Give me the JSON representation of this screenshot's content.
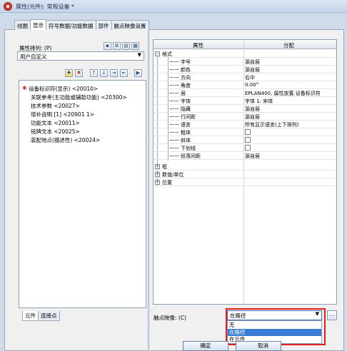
{
  "window": {
    "title": "属性(元件): 常规设备 *"
  },
  "tabs": [
    "线圈",
    "显示",
    "符号数据/功能数据",
    "部件",
    "触点映像设置"
  ],
  "left_panel": {
    "sort_label": "属性排列: (P)",
    "sort_value": "用户自定义",
    "items": [
      "设备标识符(显示) <20010>",
      "关联参考(主功能或辅助功能) <20300>",
      "技术参数 <20027>",
      "增补说明 [1] <20901 1>",
      "功能文本 <20011>",
      "铭牌文本 <20025>",
      "装配地点(描述性) <20024>"
    ],
    "bottom_tabs": [
      "元件",
      "连接点"
    ]
  },
  "property_grid": {
    "header_property": "属性",
    "header_value": "分配",
    "format_group": "格式",
    "rows": [
      {
        "label": "字号",
        "value": "源自层"
      },
      {
        "label": "颜色",
        "value": "源自层"
      },
      {
        "label": "方向",
        "value": "右中"
      },
      {
        "label": "角度",
        "value": "0.00°"
      },
      {
        "label": "层",
        "value": "EPLAN400, 属性放置.设备标识符"
      },
      {
        "label": "字体",
        "value": "字体 1: 宋体"
      },
      {
        "label": "隐藏",
        "value": "源自层"
      },
      {
        "label": "行间距",
        "value": "源自层"
      },
      {
        "label": "语言",
        "value": "所有显示语言(上下排列)"
      },
      {
        "label": "粗体",
        "value": ""
      },
      {
        "label": "斜体",
        "value": ""
      },
      {
        "label": "下划线",
        "value": ""
      },
      {
        "label": "段落间距",
        "value": "源自层"
      }
    ],
    "collapsed_groups": [
      "框",
      "数值/单位",
      "位置"
    ]
  },
  "contact_image": {
    "label": "触点映像: (C)",
    "value": "在路径",
    "options": [
      "无",
      "在路径",
      "在元件"
    ],
    "selected": "在路径"
  },
  "buttons": {
    "ok": "确定",
    "cancel": "取消"
  },
  "icons": {
    "toolbar": [
      "save-icon",
      "copy-icon",
      "paste-icon",
      "table-icon",
      "add-icon",
      "delete-icon",
      "move-up-icon",
      "move-down-icon",
      "indent-icon",
      "outdent-icon",
      "arrow-right-icon"
    ]
  }
}
